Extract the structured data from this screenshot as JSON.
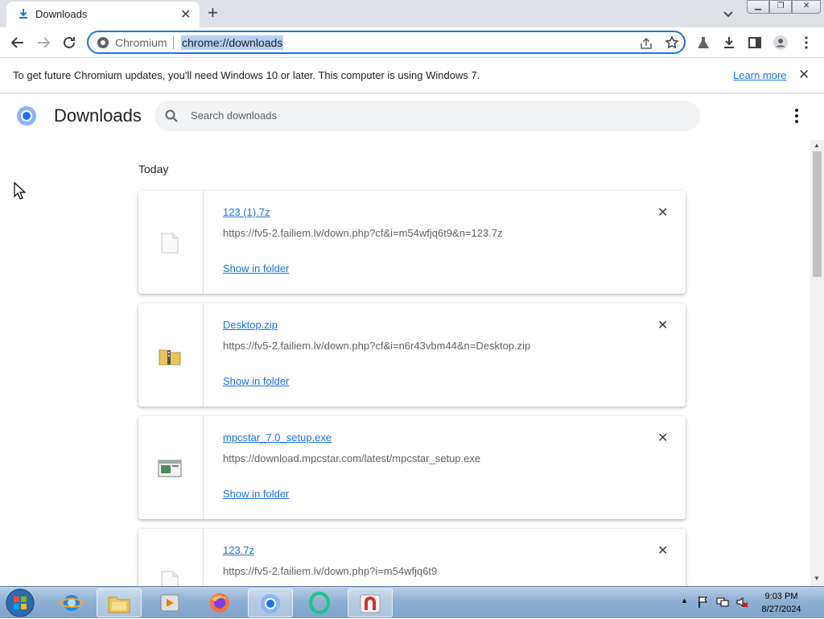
{
  "tab": {
    "title": "Downloads",
    "favicon": "download-icon"
  },
  "toolbar": {
    "site_chip": "Chromium",
    "url": "chrome://downloads"
  },
  "infobar": {
    "message": "To get future Chromium updates, you'll need Windows 10 or later. This computer is using Windows 7.",
    "link": "Learn more"
  },
  "page": {
    "title": "Downloads",
    "search_placeholder": "Search downloads",
    "date_group": "Today"
  },
  "downloads": [
    {
      "name": "123 (1).7z",
      "url": "https://fv5-2.failiem.lv/down.php?cf&i=m54wfjq6t9&n=123.7z",
      "action": "Show in folder",
      "icon": "file-icon"
    },
    {
      "name": "Desktop.zip",
      "url": "https://fv5-2.failiem.lv/down.php?cf&i=n6r43vbm44&n=Desktop.zip",
      "action": "Show in folder",
      "icon": "zip-folder-icon"
    },
    {
      "name": "mpcstar_7.0_setup.exe",
      "url": "https://download.mpcstar.com/latest/mpcstar_setup.exe",
      "action": "Show in folder",
      "icon": "exe-icon"
    },
    {
      "name": "123.7z",
      "url": "https://fv5-2.failiem.lv/down.php?i=m54wfjq6t9",
      "action": "",
      "icon": "file-icon"
    }
  ],
  "taskbar": {
    "apps": [
      "internet-explorer",
      "file-explorer",
      "media-player",
      "firefox",
      "chromium",
      "opera-gx",
      "app-red"
    ],
    "time": "9:03 PM",
    "date": "8/27/2024"
  },
  "colors": {
    "accent": "#1a73e8",
    "tabstrip": "#dee1e6",
    "taskbar": "#8fb0d3"
  }
}
